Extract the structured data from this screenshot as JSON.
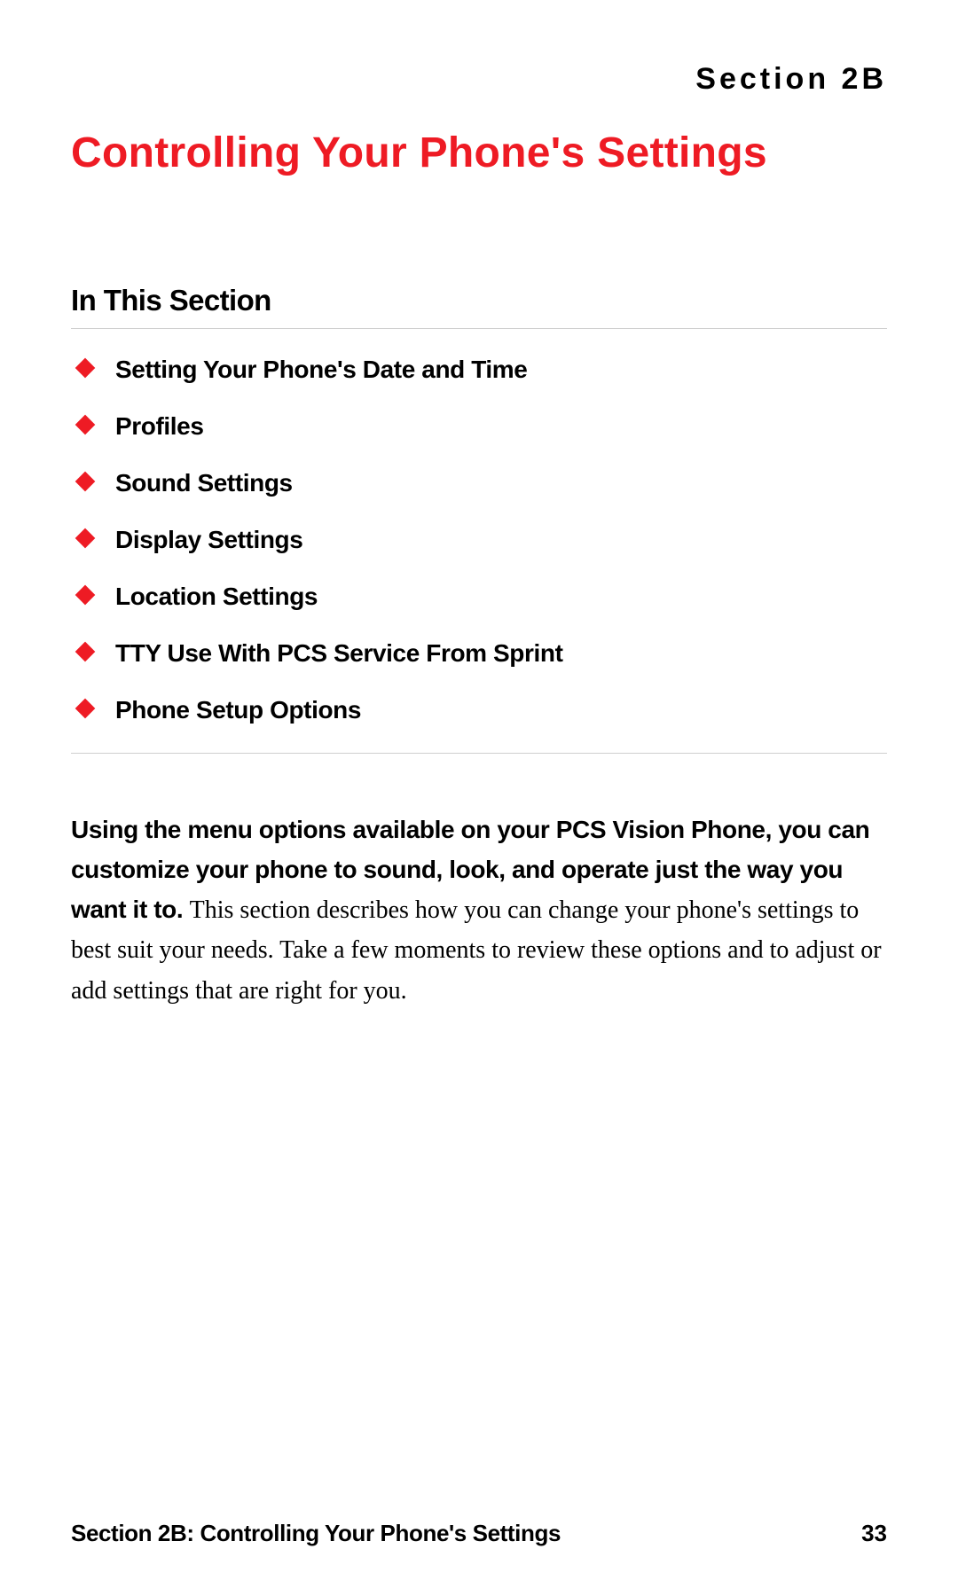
{
  "header": {
    "section_label": "Section 2B",
    "title": "Controlling Your Phone's Settings"
  },
  "subsection": {
    "title": "In This Section",
    "items": [
      "Setting Your Phone's Date and Time",
      "Profiles",
      "Sound Settings",
      "Display Settings",
      "Location Settings",
      "TTY Use With PCS Service From Sprint",
      "Phone Setup Options"
    ]
  },
  "body": {
    "bold_lead": "Using the menu options available on your PCS Vision Phone, you can customize your phone to sound, look, and operate just the way you want it to. ",
    "normal": "This section describes how you can change your phone's settings to best suit your needs. Take a few moments to review these options and to adjust or add settings that are right for you."
  },
  "footer": {
    "left": "Section 2B: Controlling Your Phone's Settings",
    "page": "33"
  }
}
